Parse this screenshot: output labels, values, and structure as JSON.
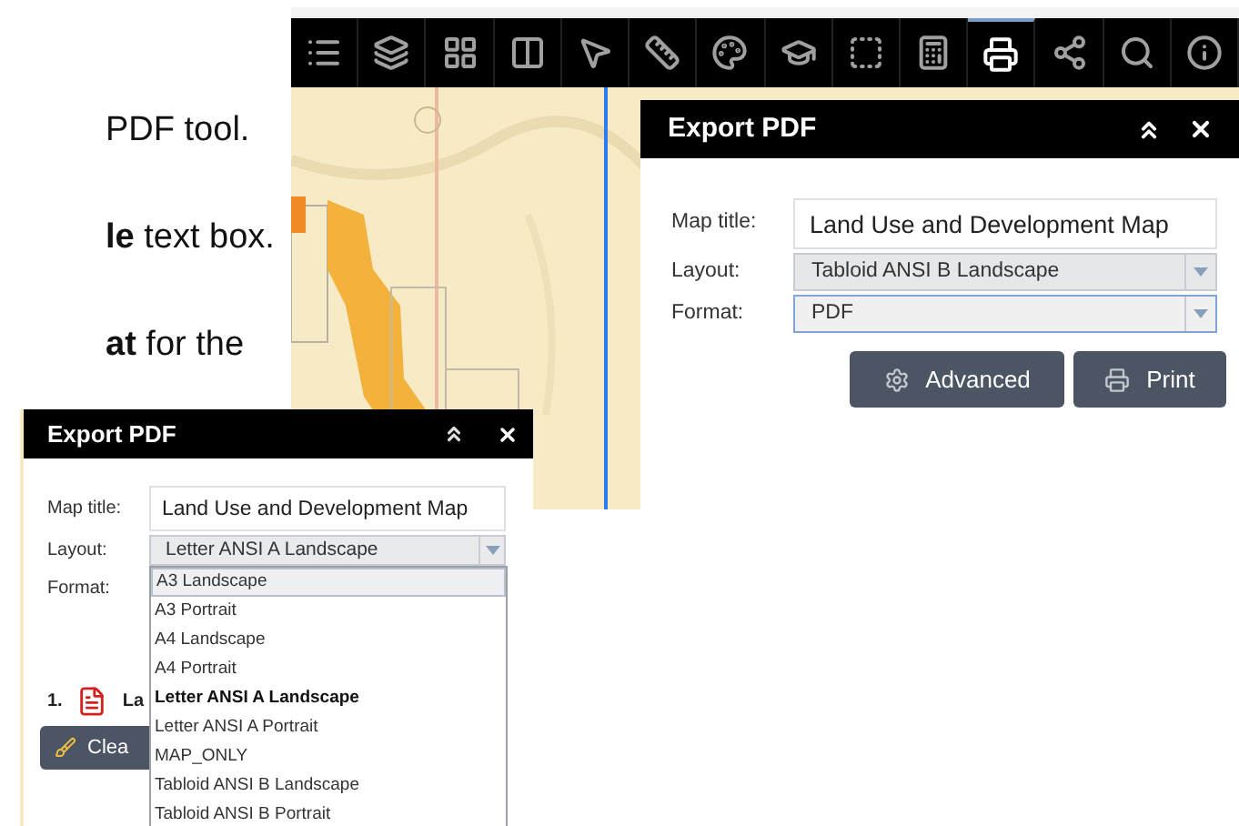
{
  "document_lines": [
    {
      "text": "PDF tool."
    },
    {
      "text": "**le** text box."
    },
    {
      "text": "**at** for the"
    }
  ],
  "toolbar": {
    "items": [
      {
        "selected": false
      },
      {
        "selected": false
      },
      {
        "selected": false
      },
      {
        "selected": false
      },
      {
        "selected": false
      },
      {
        "selected": false
      },
      {
        "selected": false
      },
      {
        "selected": false
      },
      {
        "selected": false
      },
      {
        "selected": false
      },
      {
        "selected": true
      },
      {
        "selected": false
      },
      {
        "selected": false
      },
      {
        "selected": false
      }
    ]
  },
  "export_panel": {
    "title": "Export PDF",
    "fields": [
      {
        "kind": "text",
        "label": "Map title:",
        "value": "Land Use and Development Map"
      },
      {
        "kind": "select",
        "label": "Layout:",
        "value": "Tabloid ANSI B Landscape",
        "focused": false
      },
      {
        "kind": "select",
        "label": "Format:",
        "value": "PDF",
        "focused": true
      }
    ],
    "buttons": [
      {
        "kind": "advanced",
        "label": "Advanced"
      },
      {
        "kind": "print",
        "label": "Print"
      }
    ]
  },
  "export_panel_dropdown": {
    "title": "Export PDF",
    "fields": [
      {
        "kind": "text",
        "label": "Map title:",
        "value": "Land Use and Development Map"
      },
      {
        "kind": "select",
        "label": "Layout:",
        "value": "Letter ANSI A Landscape",
        "expanded": true,
        "options": [
          {
            "label": "A3 Landscape",
            "highlighted": true,
            "selected": false
          },
          {
            "label": "A3 Portrait",
            "highlighted": false,
            "selected": false
          },
          {
            "label": "A4 Landscape",
            "highlighted": false,
            "selected": false
          },
          {
            "label": "A4 Portrait",
            "highlighted": false,
            "selected": false
          },
          {
            "label": "Letter ANSI A Landscape",
            "highlighted": false,
            "selected": true
          },
          {
            "label": "Letter ANSI A Portrait",
            "highlighted": false,
            "selected": false
          },
          {
            "label": "MAP_ONLY",
            "highlighted": false,
            "selected": false
          },
          {
            "label": "Tabloid ANSI B Landscape",
            "highlighted": false,
            "selected": false
          },
          {
            "label": "Tabloid ANSI B Portrait",
            "highlighted": false,
            "selected": false
          }
        ]
      },
      {
        "kind": "label",
        "label": "Format:"
      }
    ],
    "results": [
      {
        "number": "1.",
        "name": "La"
      }
    ],
    "clear_button": "Clea"
  }
}
